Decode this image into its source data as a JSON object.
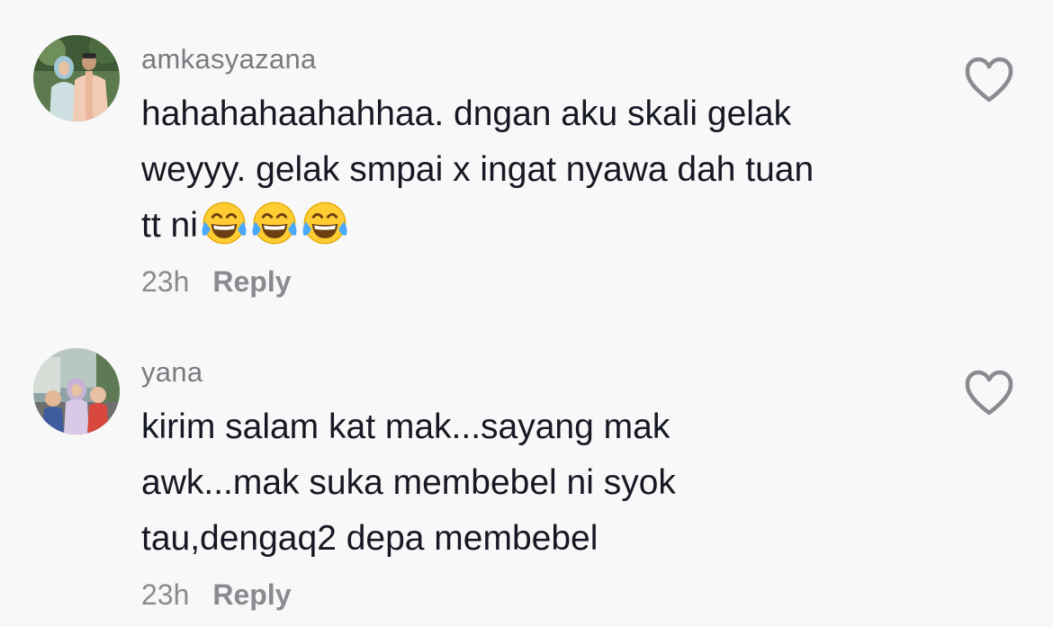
{
  "comments": [
    {
      "username": "amkasyazana",
      "lines": [
        "hahahahaahahhaa. dngan aku skali gelak",
        "weyyy. gelak smpai x ingat nyawa dah tuan",
        "tt ni"
      ],
      "emojis": [
        "😂",
        "😂",
        "😂"
      ],
      "time": "23h",
      "reply_label": "Reply",
      "like_icon": "heart-outline-icon"
    },
    {
      "username": "yana",
      "lines": [
        "kirim salam kat mak...sayang mak",
        "awk...mak suka membebel ni syok",
        "tau,dengaq2 depa membebel"
      ],
      "time": "23h",
      "reply_label": "Reply",
      "like_icon": "heart-outline-icon"
    }
  ],
  "colors": {
    "background": "#f8f8f8",
    "text": "#161823",
    "muted": "#8a8b91"
  }
}
